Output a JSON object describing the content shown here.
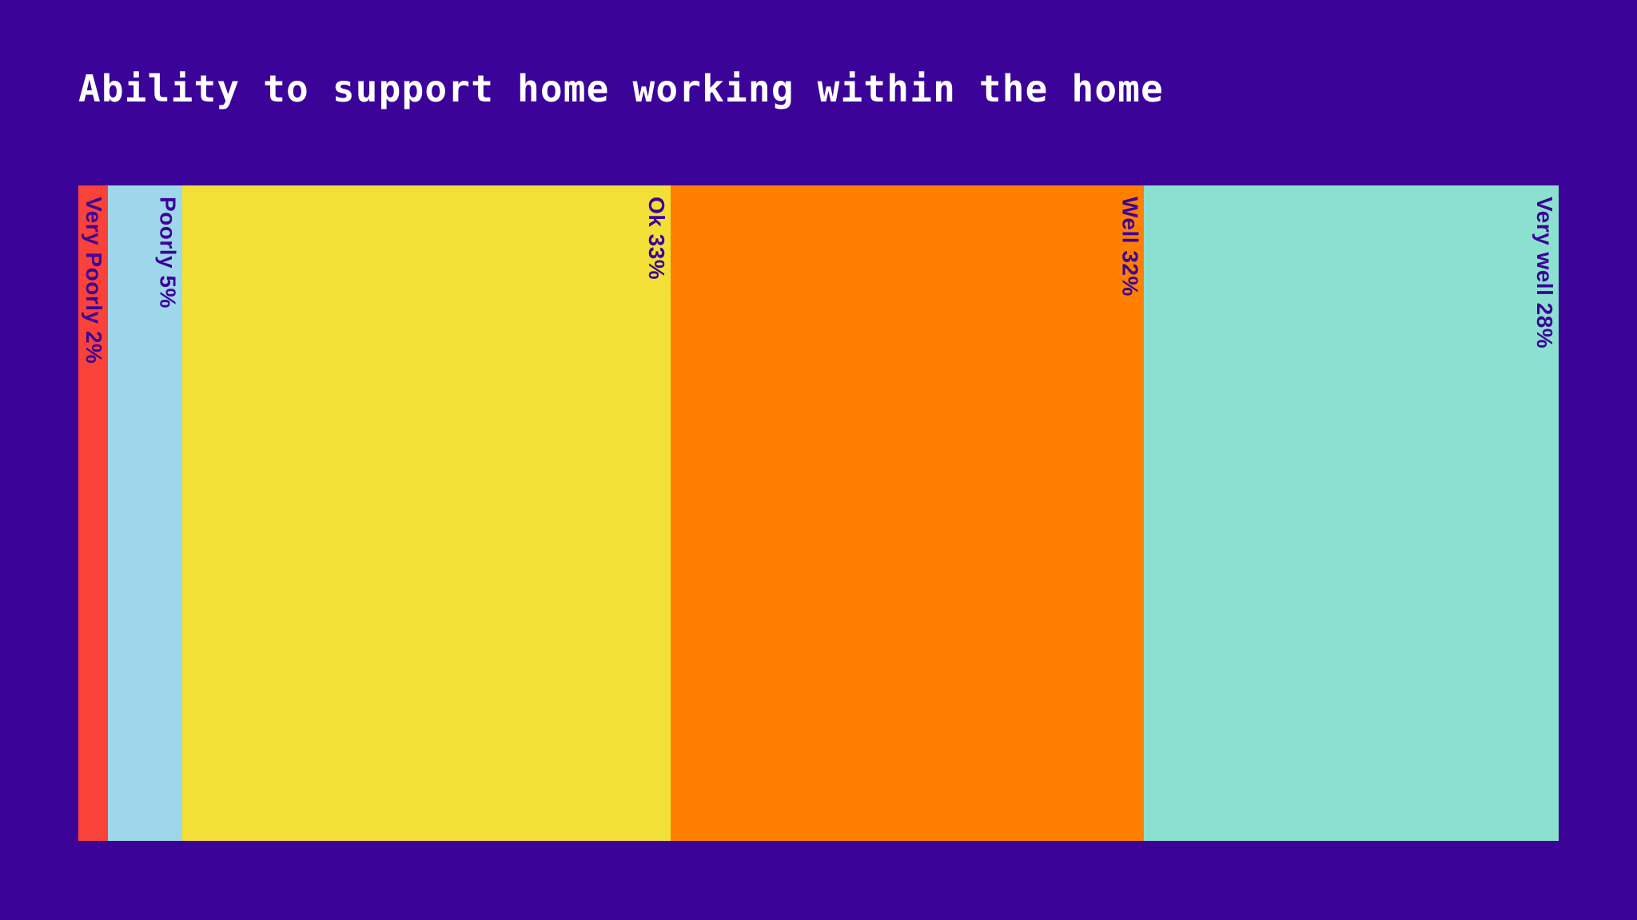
{
  "page": {
    "background_color": "#3B0398",
    "title": "Ability to support home working within the home",
    "title_color": "#FFFFFF",
    "label_color": "#3B0398"
  },
  "chart_data": {
    "type": "bar",
    "orientation": "horizontal-stacked",
    "title": "Ability to support home working within the home",
    "xlabel": "",
    "ylabel": "",
    "grid": false,
    "legend": "none",
    "value_unit": "%",
    "total": 100,
    "categories": [
      "Very Poorly",
      "Poorly",
      "Ok",
      "Well",
      "Very well"
    ],
    "values": [
      2,
      5,
      33,
      32,
      28
    ],
    "labels": [
      "Very Poorly 2%",
      "Poorly 5%",
      "Ok 33%",
      "Well 32%",
      "Very well 28%"
    ],
    "colors": [
      "#F9423A",
      "#9FD7EA",
      "#F2E038",
      "#FF8000",
      "#8CE0D0"
    ],
    "series": [
      {
        "name": "Ability to support home working within the home",
        "values": [
          2,
          5,
          33,
          32,
          28
        ]
      }
    ]
  }
}
